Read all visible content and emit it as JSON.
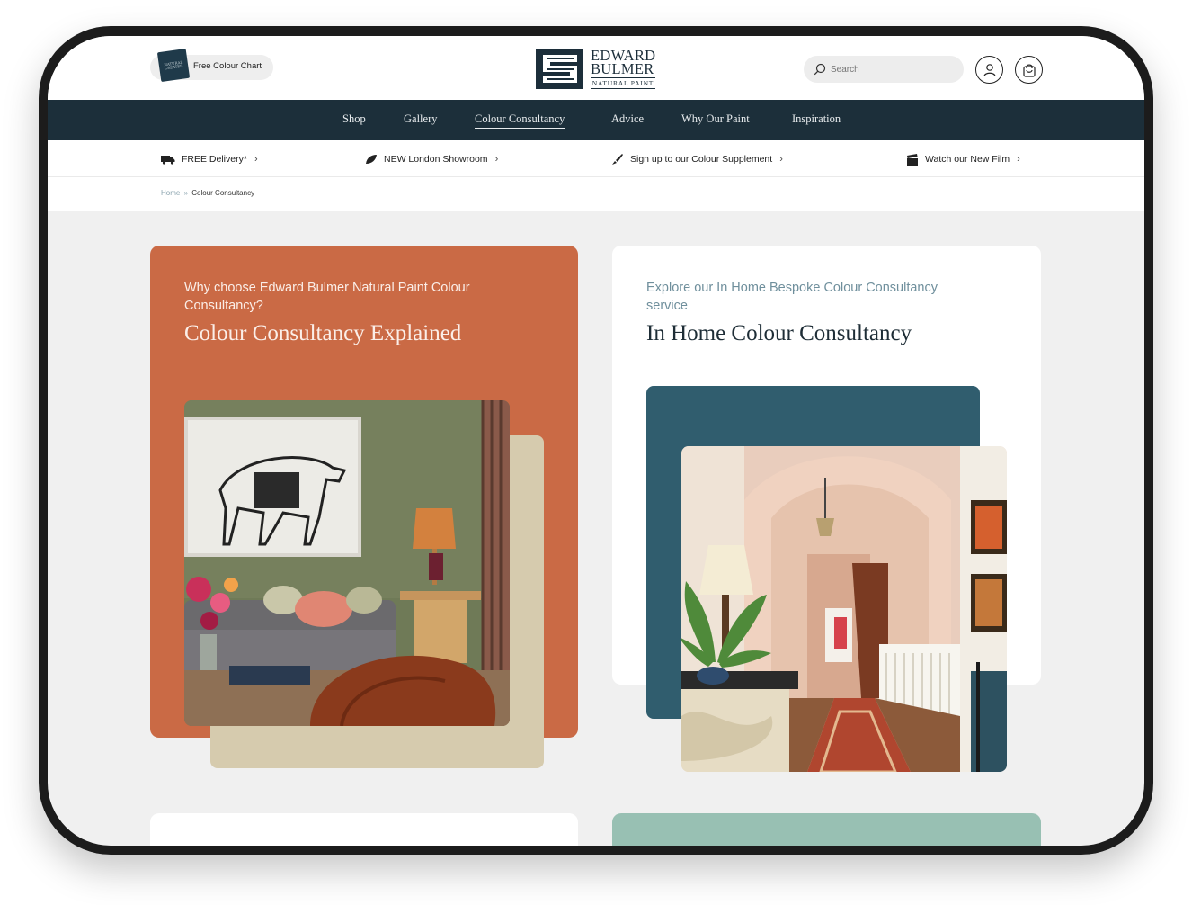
{
  "header": {
    "colour_chart_label": "Free Colour Chart",
    "colour_chart_thumb_text": "NATURAL CREATED",
    "logo": {
      "line1": "EDWARD",
      "line2": "BULMER",
      "line3": "NATURAL PAINT"
    },
    "search_placeholder": "Search"
  },
  "nav": {
    "items": [
      {
        "label": "Shop"
      },
      {
        "label": "Gallery"
      },
      {
        "label": "Colour Consultancy"
      },
      {
        "label": "Advice"
      },
      {
        "label": "Why Our Paint"
      },
      {
        "label": "Inspiration"
      }
    ],
    "active_index": 2
  },
  "promo": {
    "items": [
      {
        "label": "FREE Delivery*",
        "icon": "delivery-truck-icon"
      },
      {
        "label": "NEW London Showroom",
        "icon": "leaf-icon"
      },
      {
        "label": "Sign up to our Colour Supplement",
        "icon": "paintbrush-icon"
      },
      {
        "label": "Watch our New Film",
        "icon": "film-clapper-icon"
      }
    ]
  },
  "breadcrumb": {
    "home": "Home",
    "separator": "»",
    "current": "Colour Consultancy"
  },
  "cards": [
    {
      "kicker": "Why choose Edward Bulmer Natural Paint Colour Consultancy?",
      "title": "Colour Consultancy Explained",
      "background": "#ca6a45",
      "accent_block": "#d6cbae"
    },
    {
      "kicker": "Explore our In Home Bespoke Colour Consultancy service",
      "title": "In Home Colour Consultancy",
      "background": "#ffffff",
      "accent_block": "#305d6e"
    }
  ],
  "colors": {
    "nav_bg": "#1c2f3a",
    "page_bg": "#f0f0f0",
    "bottom_card_green": "#98c0b3"
  }
}
